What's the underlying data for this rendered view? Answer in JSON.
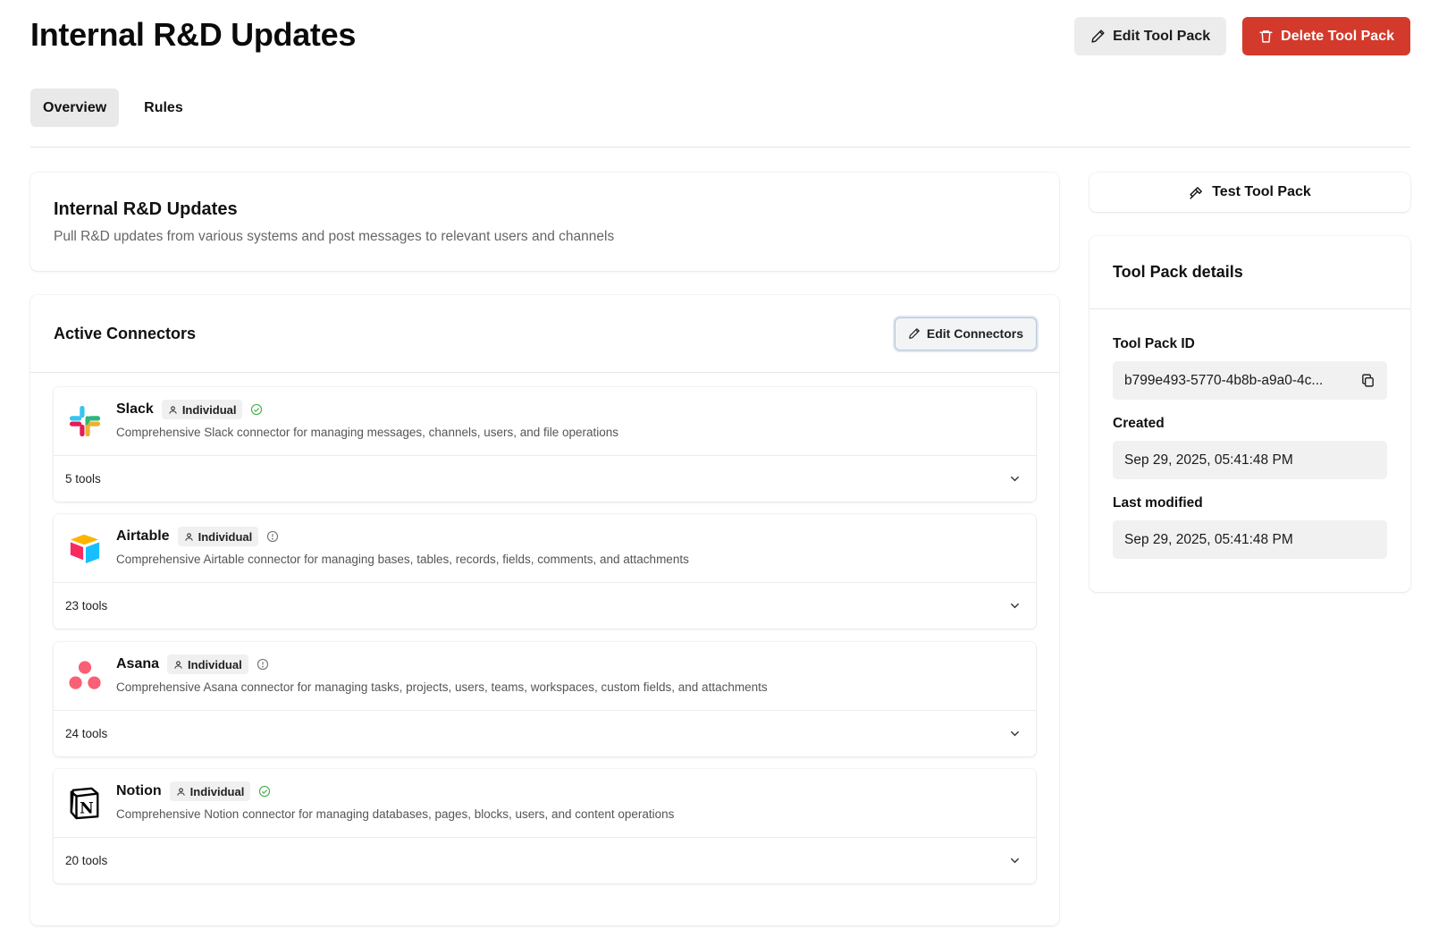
{
  "page": {
    "title": "Internal R&D Updates",
    "edit_label": "Edit Tool Pack",
    "delete_label": "Delete Tool Pack"
  },
  "tabs": [
    {
      "label": "Overview",
      "active": true
    },
    {
      "label": "Rules",
      "active": false
    }
  ],
  "overview": {
    "title": "Internal R&D Updates",
    "description": "Pull R&D updates from various systems and post messages to relevant users and channels"
  },
  "connectors": {
    "heading": "Active Connectors",
    "edit_label": "Edit Connectors",
    "items": [
      {
        "name": "Slack",
        "badge": "Individual",
        "status": "check-circle-icon",
        "description": "Comprehensive Slack connector for managing messages, channels, users, and file operations",
        "tools": "5 tools"
      },
      {
        "name": "Airtable",
        "badge": "Individual",
        "status": "info-circle-icon",
        "description": "Comprehensive Airtable connector for managing bases, tables, records, fields, comments, and attachments",
        "tools": "23 tools"
      },
      {
        "name": "Asana",
        "badge": "Individual",
        "status": "info-circle-icon",
        "description": "Comprehensive Asana connector for managing tasks, projects, users, teams, workspaces, custom fields, and attachments",
        "tools": "24 tools"
      },
      {
        "name": "Notion",
        "badge": "Individual",
        "status": "check-circle-icon",
        "description": "Comprehensive Notion connector for managing databases, pages, blocks, users, and content operations",
        "tools": "20 tools"
      }
    ]
  },
  "sidebar": {
    "test_label": "Test Tool Pack",
    "details_heading": "Tool Pack details",
    "id_label": "Tool Pack ID",
    "id_value": "b799e493-5770-4b8b-a9a0-4c...",
    "created_label": "Created",
    "created_value": "Sep 29, 2025, 05:41:48 PM",
    "modified_label": "Last modified",
    "modified_value": "Sep 29, 2025, 05:41:48 PM"
  },
  "colors": {
    "danger": "#d33a2c",
    "check_green": "#4caf50",
    "info_gray": "#777777"
  }
}
